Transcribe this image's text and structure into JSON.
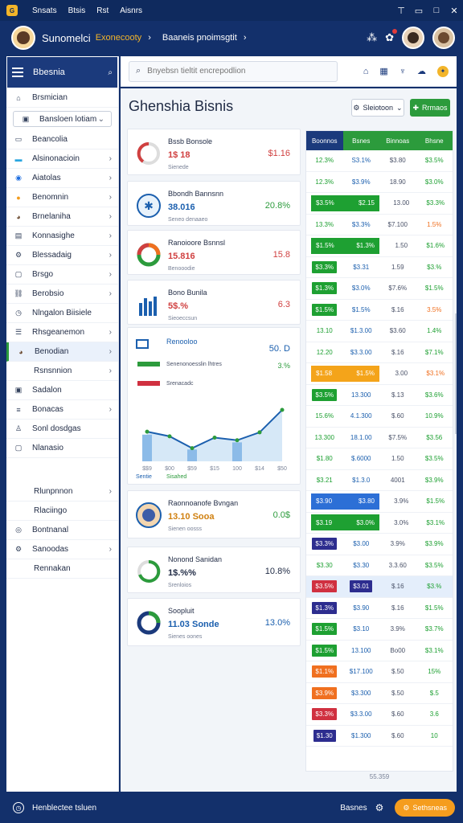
{
  "topbar": {
    "menus": [
      "Snsats",
      "Btsis",
      "Rst",
      "Aisnrs"
    ],
    "win_buttons": [
      "⊤",
      "▭",
      "□",
      "✕"
    ]
  },
  "header": {
    "app_title": "Sunomelci",
    "app_subtitle": "Exonecooty",
    "breadcrumb": "Baaneis pnoimsgtit"
  },
  "sidebar": {
    "title": "Bbesnia",
    "items": [
      {
        "label": "Brsmician",
        "icon": "pin-icon"
      },
      {
        "label": "Bansloen lotiam",
        "icon": "tag-icon"
      },
      {
        "label": "Beancolia",
        "icon": "bar-icon"
      },
      {
        "label": "Alsinonacioin",
        "icon": "card-icon"
      },
      {
        "label": "Aiatolas",
        "icon": "chat-icon"
      },
      {
        "label": "Benomnin",
        "icon": "orange-dot-icon"
      },
      {
        "label": "Brnelaniha",
        "icon": "avatar-icon"
      },
      {
        "label": "Konnasighe",
        "icon": "doc-icon"
      },
      {
        "label": "Blessadaig",
        "icon": "gear-icon"
      },
      {
        "label": "Brsgo",
        "icon": "box-icon"
      },
      {
        "label": "Berobsio",
        "icon": "link-icon"
      },
      {
        "label": "Nlngalon Biisiele",
        "icon": "clock-icon"
      },
      {
        "label": "Rhsgeanemon",
        "icon": "chart-icon"
      },
      {
        "label": "Benodian",
        "icon": "avatar-icon"
      },
      {
        "label": "Rsnsnnion",
        "icon": ""
      },
      {
        "label": "Sadalon",
        "icon": "lock-icon"
      },
      {
        "label": "Bonacas",
        "icon": "list-icon"
      },
      {
        "label": "Sonl dosdgas",
        "icon": "person-icon"
      },
      {
        "label": "Nlanasio",
        "icon": "square-icon"
      },
      {
        "label": "Rlunpnnon",
        "icon": ""
      },
      {
        "label": "Rlaciingo",
        "icon": ""
      },
      {
        "label": "Bontnanal",
        "icon": "globe-icon"
      },
      {
        "label": "Sanoodas",
        "icon": "gear-icon"
      },
      {
        "label": "Rennakan",
        "icon": ""
      }
    ]
  },
  "search": {
    "placeholder": "Bnyebsn tieltit encrepodlion"
  },
  "main": {
    "title": "Ghenshia  Bisnis",
    "filter_label": "Sleiotoon",
    "add_label": "Rrmaos"
  },
  "cards": [
    {
      "title": "Bssb Bonsole",
      "big": "1$ 18",
      "small": "Sienede",
      "value": "$1.16",
      "color": "#d04040"
    },
    {
      "title": "Bbondh Bannsnn",
      "big": "38.016",
      "small": "Seneo denaaeo",
      "value": "20.8%",
      "color": "#1b5fae"
    },
    {
      "title": "Ranoioore Bsnnsl",
      "big": "15.816",
      "small": "Benooodie",
      "value": "15.8",
      "color": "#d04040"
    },
    {
      "title": "Bono Bunila",
      "big": "5$.%",
      "small": "Sieoeccsun",
      "value": "6.3",
      "color": "#d04040"
    },
    {
      "title": "Renooloo",
      "big": "",
      "small": "",
      "value": "50. D",
      "color": "#1b5fae"
    },
    {
      "title": "Raonnoanofe Bvngan",
      "big": "13.10 Sooa",
      "small": "Sienen oosss",
      "value": "0.0$",
      "color": "#d08010"
    },
    {
      "title": "Nonond Sanidan",
      "big": "1$.%%",
      "small": "Srenloios",
      "value": "10.8%",
      "color": "#1f2a44"
    },
    {
      "title": "Soopluit",
      "big": "11.03 Sonde",
      "small": "Sienes oones",
      "value": "13.0%",
      "color": "#1b5fae"
    }
  ],
  "chart": {
    "legend_1": "Srenacadc",
    "legend_2": "Senenonoesslin lhtres",
    "legend_3": "Sisahed",
    "pct": "3.%",
    "axis_labels": [
      "$$9",
      "$00",
      "$59",
      "$15",
      "100",
      "$14",
      "$50"
    ],
    "footer_label": "Sentie"
  },
  "chart_data": {
    "type": "bar",
    "categories": [
      "$$9",
      "$00",
      "$59",
      "$15",
      "100",
      "$14",
      "$50"
    ],
    "series": [
      {
        "values": [
          45,
          38,
          20,
          36,
          32,
          44,
          78
        ]
      }
    ],
    "ylim": [
      0,
      100
    ]
  },
  "table": {
    "headers": [
      "Boonnos",
      "Bsnes",
      "Binnoas",
      "Bhsne"
    ],
    "header_colors": [
      "#1b3a7c",
      "#2c9b3c",
      "#2c9b3c",
      "#2c9b3c"
    ],
    "rows": [
      [
        "12.3%",
        "S3.1%",
        "$3.80",
        "$3.5%"
      ],
      [
        "12.3%",
        "$3.9%",
        "18.90",
        "$3.0%"
      ],
      [
        "$3.5%",
        "$2.15",
        "13.00",
        "$3.3%"
      ],
      [
        "13.3%",
        "$3.3%",
        "$7.100",
        "1.5%"
      ],
      [
        "$1.5%",
        "$1.3%",
        "1.50",
        "$1.6%"
      ],
      [
        "$3.3%",
        "$3.31",
        "1.59",
        "$3.%"
      ],
      [
        "$1.3%",
        "$3.0%",
        "$7.6%",
        "$1.5%"
      ],
      [
        "$1.5%",
        "$1.5%",
        "$.16",
        "3.5%"
      ],
      [
        "13.10",
        "$1.3.00",
        "$3.60",
        "1.4%"
      ],
      [
        "12.20",
        "$3.3.00",
        "$.16",
        "$7.1%"
      ],
      [
        "$1.58",
        "$1.5%",
        "3.00",
        "$3.1%"
      ],
      [
        "$3.5%",
        "13.300",
        "$.13",
        "$3.6%"
      ],
      [
        "15.6%",
        "4.1.300",
        "$.60",
        "10.9%"
      ],
      [
        "13.300",
        "18.1.00",
        "$7.5%",
        "$3.56"
      ],
      [
        "$1.80",
        "$.6000",
        "1.50",
        "$3.5%"
      ],
      [
        "$3.21",
        "$1.3.0",
        "4001",
        "$3.9%"
      ],
      [
        "$3.90",
        "$3.80",
        "3.9%",
        "$1.5%"
      ],
      [
        "$3.19",
        "$3.0%",
        "3.0%",
        "$3.1%"
      ],
      [
        "$3.3%",
        "$3.00",
        "3.9%",
        "$3.9%"
      ],
      [
        "$3.30",
        "$3.30",
        "3.3.60",
        "$3.5%"
      ],
      [
        "$3.5%",
        "$3.01",
        "$.16",
        "$3.%"
      ],
      [
        "$1.3%",
        "$3.90",
        "$.16",
        "$1.5%"
      ],
      [
        "$1.5%",
        "$3.10",
        "3.9%",
        "$3.7%"
      ],
      [
        "$1.5%",
        "13.100",
        "Bo00",
        "$3.1%"
      ],
      [
        "$1.1%",
        "$17.100",
        "$.50",
        "15%"
      ],
      [
        "$3.9%",
        "$3.300",
        "$.50",
        "$.5"
      ],
      [
        "$3.3%",
        "$3.3.00",
        "$.60",
        "3.6"
      ],
      [
        "$1.30",
        "$1.300",
        "$.60",
        "10"
      ]
    ],
    "chip_cols": [
      [
        null,
        null,
        null,
        null
      ],
      [
        null,
        null,
        null,
        null
      ],
      [
        "#1ea032",
        "wide:#1ea032",
        null,
        null
      ],
      [
        null,
        null,
        null,
        null
      ],
      [
        "#1ea032",
        "wide:#1ea032",
        null,
        null
      ],
      [
        "#1ea032",
        null,
        null,
        null
      ],
      [
        "#1ea032",
        null,
        null,
        null
      ],
      [
        "#1ea032",
        null,
        null,
        null
      ],
      [
        null,
        null,
        null,
        null
      ],
      [
        null,
        null,
        null,
        null
      ],
      [
        "#f4a41a",
        "wide:#f4a41a",
        null,
        null
      ],
      [
        "#1ea032",
        null,
        null,
        null
      ],
      [
        null,
        null,
        null,
        null
      ],
      [
        null,
        null,
        null,
        null
      ],
      [
        null,
        null,
        null,
        null
      ],
      [
        null,
        null,
        null,
        null
      ],
      [
        "#2c6fd6",
        "wide:#2c6fd6",
        null,
        null
      ],
      [
        "#1ea032",
        "wide:#1ea032",
        null,
        null
      ],
      [
        "#2d2d8f",
        null,
        null,
        null
      ],
      [
        null,
        null,
        null,
        null
      ],
      [
        "#d03040",
        "#2d2d8f",
        null,
        null
      ],
      [
        "#2d2d8f",
        null,
        null,
        null
      ],
      [
        "#1ea032",
        null,
        null,
        null
      ],
      [
        "#1ea032",
        null,
        null,
        null
      ],
      [
        "#f07020",
        null,
        null,
        null
      ],
      [
        "#f07020",
        null,
        null,
        null
      ],
      [
        "#d03040",
        null,
        null,
        null
      ],
      [
        "#2d2d8f",
        null,
        null,
        null
      ]
    ],
    "footer": "55.359"
  },
  "statusbar": {
    "label": "Henblectee tsluen",
    "right_label": "Basnes",
    "button": "Sethsneas"
  }
}
